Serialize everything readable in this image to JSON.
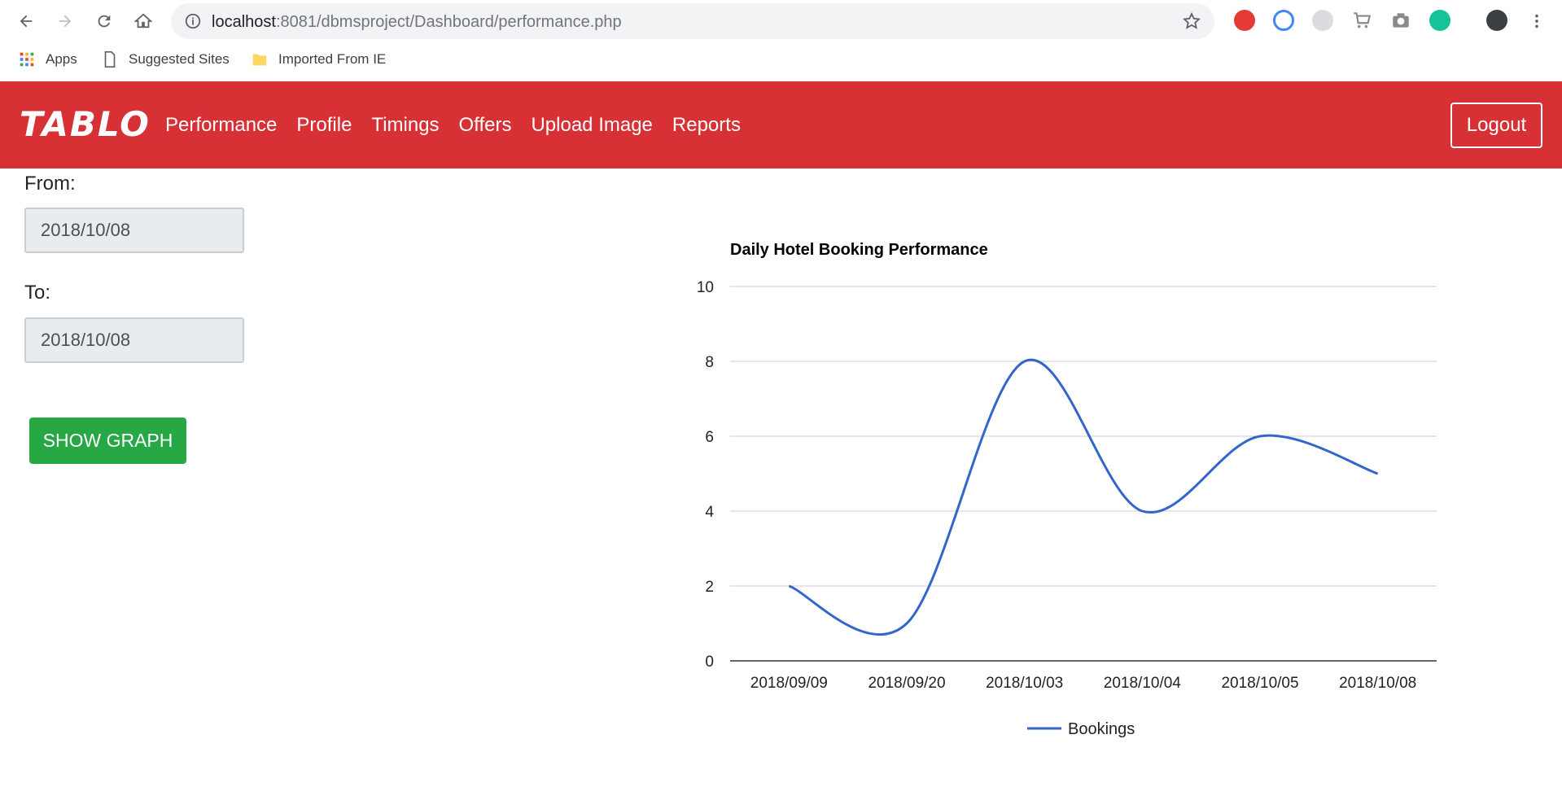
{
  "browser": {
    "url_host": "localhost",
    "url_rest": ":8081/dbmsproject/Dashboard/performance.php",
    "bookmarks": [
      "Apps",
      "Suggested Sites",
      "Imported From IE"
    ]
  },
  "navbar": {
    "brand": "TABLO",
    "links": [
      "Performance",
      "Profile",
      "Timings",
      "Offers",
      "Upload Image",
      "Reports"
    ],
    "logout": "Logout"
  },
  "form": {
    "from_label": "From:",
    "from_value": "2018/10/08",
    "to_label": "To:",
    "to_value": "2018/10/08",
    "button": "SHOW GRAPH"
  },
  "colors": {
    "navbar": "#d73035",
    "button": "#28a745",
    "series": "#3366cc"
  },
  "chart_data": {
    "type": "line",
    "title": "Daily Hotel Booking Performance",
    "categories": [
      "2018/09/09",
      "2018/09/20",
      "2018/10/03",
      "2018/10/04",
      "2018/10/05",
      "2018/10/08"
    ],
    "series": [
      {
        "name": "Bookings",
        "values": [
          2,
          1,
          8,
          4,
          6,
          5
        ]
      }
    ],
    "ylim": [
      0,
      10
    ],
    "yticks": [
      0,
      2,
      4,
      6,
      8,
      10
    ],
    "grid": true,
    "legend": "bottom",
    "curve": "smooth"
  }
}
